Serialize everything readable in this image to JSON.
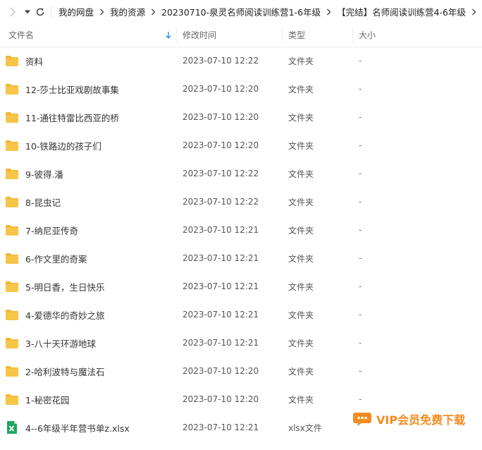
{
  "breadcrumbs": [
    "我的网盘",
    "我的资源",
    "20230710-泉灵名师阅读训练营1-6年级",
    "【完结】名师阅读训练营4-6年级"
  ],
  "columns": {
    "name": "文件名",
    "modified": "修改时间",
    "type": "类型",
    "size": "大小"
  },
  "files": [
    {
      "name": "资料",
      "modified": "2023-07-10 12:22",
      "type": "文件夹",
      "size": "-",
      "icon": "folder-icon"
    },
    {
      "name": "12-莎士比亚戏剧故事集",
      "modified": "2023-07-10 12:20",
      "type": "文件夹",
      "size": "-",
      "icon": "folder-icon"
    },
    {
      "name": "11-通往特雷比西亚的桥",
      "modified": "2023-07-10 12:20",
      "type": "文件夹",
      "size": "-",
      "icon": "folder-icon"
    },
    {
      "name": "10-铁路边的孩子们",
      "modified": "2023-07-10 12:20",
      "type": "文件夹",
      "size": "-",
      "icon": "folder-icon"
    },
    {
      "name": "9-彼得.潘",
      "modified": "2023-07-10 12:22",
      "type": "文件夹",
      "size": "-",
      "icon": "folder-icon"
    },
    {
      "name": "8-昆虫记",
      "modified": "2023-07-10 12:22",
      "type": "文件夹",
      "size": "-",
      "icon": "folder-icon"
    },
    {
      "name": "7-纳尼亚传奇",
      "modified": "2023-07-10 12:21",
      "type": "文件夹",
      "size": "-",
      "icon": "folder-icon"
    },
    {
      "name": "6-作文里的奇案",
      "modified": "2023-07-10 12:21",
      "type": "文件夹",
      "size": "-",
      "icon": "folder-icon"
    },
    {
      "name": "5-明日香，生日快乐",
      "modified": "2023-07-10 12:21",
      "type": "文件夹",
      "size": "-",
      "icon": "folder-icon"
    },
    {
      "name": "4-爱德华的奇妙之旅",
      "modified": "2023-07-10 12:21",
      "type": "文件夹",
      "size": "-",
      "icon": "folder-icon"
    },
    {
      "name": "3-八十天环游地球",
      "modified": "2023-07-10 12:21",
      "type": "文件夹",
      "size": "-",
      "icon": "folder-icon"
    },
    {
      "name": "2-哈利波特与魔法石",
      "modified": "2023-07-10 12:20",
      "type": "文件夹",
      "size": "-",
      "icon": "folder-icon"
    },
    {
      "name": "1-秘密花园",
      "modified": "2023-07-10 12:20",
      "type": "文件夹",
      "size": "-",
      "icon": "folder-icon"
    },
    {
      "name": "4--6年级半年营书单z.xlsx",
      "modified": "2023-07-10 12:21",
      "type": "xlsx文件",
      "size": "",
      "icon": "excel-file-icon"
    }
  ],
  "watermark": {
    "text": "VIP会员免费下载",
    "icon": "chat-bubble-icon"
  },
  "colors": {
    "folder": "#f7c548",
    "folder_tab": "#f2b632",
    "excel": "#1fa463",
    "watermark": "#f28c1e",
    "sort_arrow": "#3d8ef0"
  }
}
